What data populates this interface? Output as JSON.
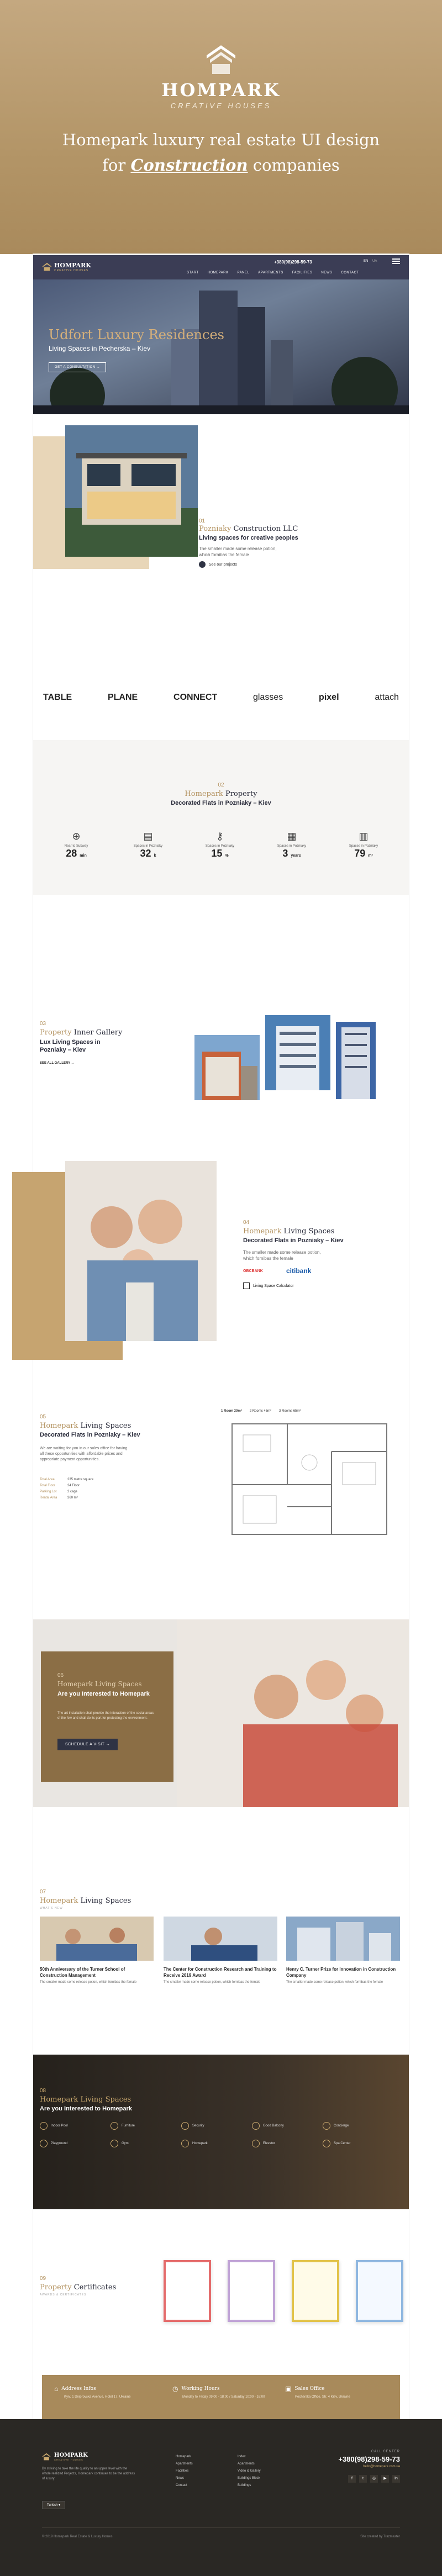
{
  "hero": {
    "brand_name": "HOMPARK",
    "brand_tagline": "CREATIVE HOUSES",
    "headline_line1": "Homepark luxury real estate UI design",
    "headline_line2_prefix": "for ",
    "headline_line2_em": "Construction",
    "headline_line2_suffix": " companies"
  },
  "nav": {
    "logo": "HOMPARK",
    "logo_sub": "CREATIVE HOUSES",
    "phone": "+380(98)298-59-73",
    "lang": [
      "EN",
      "UA"
    ],
    "items": [
      "START",
      "HOMEPARK",
      "PANEL",
      "APARTMENTS",
      "FACILITIES",
      "NEWS",
      "CONTACT"
    ]
  },
  "banner": {
    "title": "Udfort Luxury Residences",
    "subtitle": "Living Spaces in Pecherska – Kiev",
    "cta": "GET A CONSULTATION"
  },
  "about": {
    "num": "01",
    "title_gold": "Pozniaky",
    "title_rest": " Construction LLC",
    "subtitle": "Living spaces for creative peoples",
    "body": "The smaller made some release potion, which fornibas the female",
    "link": "See our projects"
  },
  "partners": [
    "TABLE",
    "PLANE",
    "CONNECT",
    "glasses",
    "pixel",
    "attach"
  ],
  "stats": {
    "num": "02",
    "title_gold": "Homepark",
    "title_rest": " Property",
    "subtitle": "Decorated Flats in Pozniaky – Kiev",
    "items": [
      {
        "label": "Near to Subway",
        "value": "28",
        "unit": "min"
      },
      {
        "label": "Spaces in Pozniaky",
        "value": "32",
        "unit": "k"
      },
      {
        "label": "Spaces in Pozniaky",
        "value": "15",
        "unit": "%"
      },
      {
        "label": "Spaces in Pozniaky",
        "value": "3",
        "unit": "years"
      },
      {
        "label": "Spaces in Pozniaky",
        "value": "79",
        "unit": "m²"
      }
    ]
  },
  "gallery": {
    "num": "03",
    "title_gold": "Property",
    "title_rest": " Inner Gallery",
    "subtitle_line1": "Lux Living Spaces in",
    "subtitle_line2": "Pozniaky – Kiev",
    "link": "SEE ALL GALLERY"
  },
  "family": {
    "num": "04",
    "title_gold": "Homepark",
    "title_rest": " Living Spaces",
    "subtitle": "Decorated Flats in Pozniaky – Kiev",
    "body": "The smaller made some release potion, which fornibas the female",
    "bank1": "OBCBANK",
    "bank2": "citibank",
    "calc": "Living Space Calculator"
  },
  "plan": {
    "num": "05",
    "title_gold": "Homepark",
    "title_rest": " Living Spaces",
    "subtitle": "Decorated Flats in Pozniaky – Kiev",
    "body": "We are waiting for you in our sales office for having all these opportunities with affordable prices and appropriate payment opportunities.",
    "tabs": [
      "1 Room 30m²",
      "2 Rooms 45m²",
      "3 Rooms 65m²"
    ],
    "specs": [
      {
        "k": "Total Area",
        "v": "235 metre square"
      },
      {
        "k": "Total Floor",
        "v": "24 Floor"
      },
      {
        "k": "Parking Lot",
        "v": "2 cage"
      },
      {
        "k": "Rental Area",
        "v": "360 m²"
      }
    ]
  },
  "interest": {
    "num": "06",
    "title_gold": "Homepark Living Spaces",
    "title_white": "Are you Interested to Homepark",
    "body": "The art installation shall provide the interaction of the social areas of the few and shall do its part for protecting the environment.",
    "cta": "SCHEDULE A VISIT"
  },
  "news": {
    "num": "07",
    "title_gold": "Homepark",
    "title_rest": " Living Spaces",
    "sub": "WHAT'S NEW",
    "items": [
      {
        "title": "50th Anniversary of the Turner School of Construction Management",
        "body": "The smaller made some release potion, which fornibas the female"
      },
      {
        "title": "The Center for Construction Research and Training to Receive 2019 Award",
        "body": "The smaller made some release potion, which fornibas the female"
      },
      {
        "title": "Henry C. Turner Prize for Innovation in Construction Company",
        "body": "The smaller made some release potion, which fornibas the female"
      }
    ]
  },
  "features": {
    "num": "08",
    "title_gold": "Homepark Living Spaces",
    "title_white": "Are you Interested to Homepark",
    "items": [
      "Indoor Pool",
      "Furniture",
      "Security",
      "Good Balcony",
      "Concierge",
      "Playground",
      "Gym",
      "Homepark",
      "Elevator",
      "Spa Center"
    ]
  },
  "certs": {
    "num": "09",
    "title_gold": "Property",
    "title_rest": " Certificates",
    "sub": "AWARDS & CERTIFICATES"
  },
  "info": {
    "address_title": "Address Infos",
    "address": "Kyiv, 1 Dniprovska Avenue, Hotel 17, Ukraine",
    "hours_title": "Working Hours",
    "hours": "Monday to Friday 09:00 - 18:00 / Saturday 10:00 - 16:00",
    "sales_title": "Sales Office",
    "sales": "Pecherska Office, Str. 4 Kiev, Ukraine"
  },
  "footer": {
    "logo": "HOMPARK",
    "logo_sub": "CREATIVE HOUSES",
    "about": "By striving to take the life quality to an upper level with the whole realized Projects, Homepark continues to be the address of luxury.",
    "lang": "Turkish",
    "col1": [
      "Homepark",
      "Apartments",
      "Facilities",
      "News",
      "Contact"
    ],
    "col2": [
      "Index",
      "Apartments",
      "Video & Gallery",
      "Buildings Block",
      "Buildings"
    ],
    "call_center_label": "CALL CENTER",
    "phone": "+380(98)298-59-73",
    "email": "hello@homepark.com.ua",
    "copyright": "© 2019 Homepark Real Estate & Luxury Homes",
    "credit": "Site created by Trazmaster"
  },
  "colors": {
    "gold": "#b3925f",
    "navy": "#2b2d3c",
    "dark": "#2a2824"
  }
}
